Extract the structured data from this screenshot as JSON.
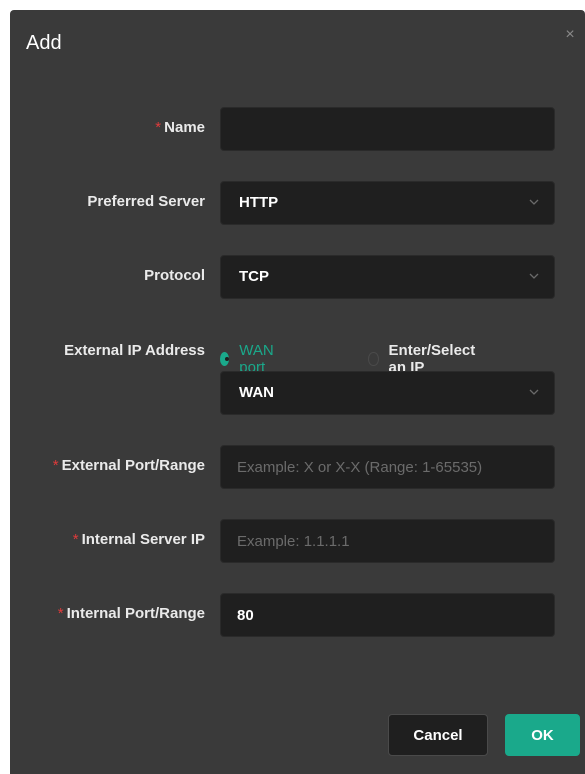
{
  "dialog": {
    "title": "Add",
    "close_icon": "×"
  },
  "form": {
    "required_mark": "*",
    "name": {
      "label": "Name",
      "value": "",
      "placeholder": ""
    },
    "preferred_server": {
      "label": "Preferred Server",
      "value": "HTTP"
    },
    "protocol": {
      "label": "Protocol",
      "value": "TCP"
    },
    "external_ip": {
      "label": "External IP Address",
      "options": [
        "WAN port",
        "Enter/Select an IP"
      ],
      "selected": "WAN port",
      "interface_value": "WAN"
    },
    "external_port": {
      "label": "External Port/Range",
      "value": "",
      "placeholder": "Example: X or X-X (Range: 1-65535)"
    },
    "internal_server_ip": {
      "label": "Internal Server IP",
      "value": "",
      "placeholder": "Example: 1.1.1.1"
    },
    "internal_port": {
      "label": "Internal Port/Range",
      "value": "80",
      "placeholder": ""
    }
  },
  "buttons": {
    "cancel_label": "Cancel",
    "ok_label": "OK"
  },
  "colors": {
    "accent": "#1aa98b",
    "required": "#e03b3b",
    "dialog_bg": "#3a3a3a",
    "field_bg": "#1f1f1f"
  }
}
